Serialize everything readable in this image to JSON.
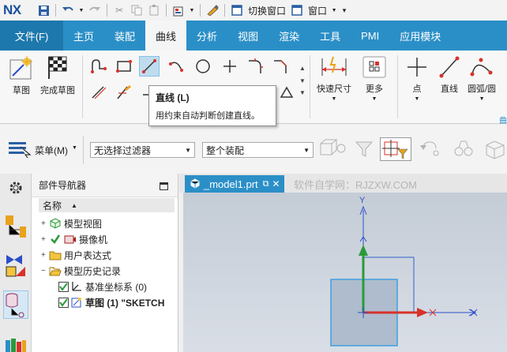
{
  "app": {
    "logo": "NX"
  },
  "quick_access": {
    "switch_window": "切换窗口",
    "window_menu": "窗口"
  },
  "tabs": [
    {
      "label": "文件(F)"
    },
    {
      "label": "主页"
    },
    {
      "label": "装配"
    },
    {
      "label": "曲线"
    },
    {
      "label": "分析"
    },
    {
      "label": "视图"
    },
    {
      "label": "渲染"
    },
    {
      "label": "工具"
    },
    {
      "label": "PMI"
    },
    {
      "label": "应用模块"
    }
  ],
  "active_tab": "曲线",
  "ribbon": {
    "sketch": "草图",
    "finish_sketch": "完成草图",
    "quick_dimension": "快速尺寸",
    "more": "更多",
    "point": "点",
    "line": "直线",
    "arc_circle": "圆弧/圆",
    "group_label_clipped": "曲"
  },
  "tooltip": {
    "title": "直线 (L)",
    "description": "用约束自动判断创建直线。"
  },
  "filterbar": {
    "menu": "菜单(M)",
    "type_filter": "无选择过滤器",
    "scope": "整个装配"
  },
  "navigator": {
    "title": "部件导航器",
    "column_name": "名称",
    "items": [
      {
        "label": "模型视图"
      },
      {
        "label": "摄像机"
      },
      {
        "label": "用户表达式"
      },
      {
        "label": "模型历史记录"
      },
      {
        "label": "基准坐标系 (0)"
      },
      {
        "label": "草图 (1) \"SKETCH"
      }
    ]
  },
  "graphics": {
    "tab_label": "_model1.prt",
    "watermark": "软件自学网：RJZXW.COM",
    "axis_y": "Y",
    "axis_x": "X"
  },
  "colors": {
    "accent": "#2b8fc7",
    "tab_dark": "#1d78ad",
    "axis_y": "#2a9a3a",
    "axis_x": "#d8322a",
    "axis_z": "#2c4fc8"
  }
}
